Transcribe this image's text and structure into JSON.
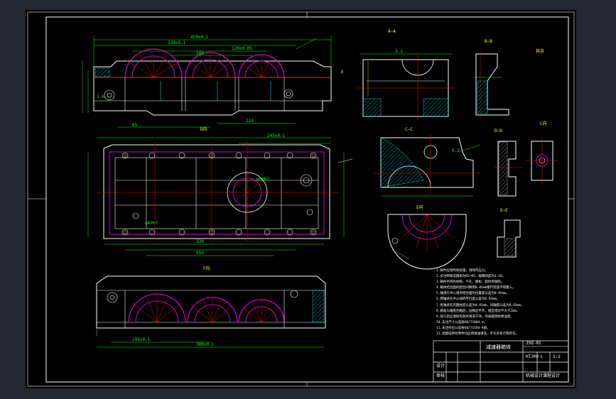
{
  "section_labels": {
    "a_a": "A—A",
    "b_b": "B—B",
    "c_c": "C—C",
    "d_d": "D—D",
    "e_e": "E—E",
    "f_f": "F",
    "view_d": "D向",
    "view_c": "C向",
    "view_e": "E向",
    "view_f": "F向",
    "other": "其余"
  },
  "dimensions": {
    "d1": "220±0.1",
    "d2": "245±0.1",
    "d3": "450±0.1",
    "d4": "120±0.05",
    "d5": "180",
    "d6": "330",
    "d7": "550",
    "d8": "65",
    "d9": "110",
    "d10": "φ80H7",
    "d11": "φ62H7",
    "d12": "195±0.1",
    "d13": "380±0.1",
    "d14": "3.2",
    "d15": "6.3",
    "d16": "1.6"
  },
  "technical_requirements": [
    "1.铸件应经时效处理，消除内应力。",
    "2.未注明铸造圆角为R3~R5，拔模斜度为1:20。",
    "3.铸件不得有砂眼、气孔、缩松、裂纹等缺陷。",
    "4.箱体结合面的配合间隙用0.05mm塞尺检查不得塞入。",
    "5.轴承孔中心线对结合面的位置度公差为0.05mm。",
    "6.两轴承孔中心线的平行度公差为0.03mm。",
    "7.各轴承孔的圆柱度公差为0.01mm，同轴度公差为0.02mm。",
    "8.箱盖与箱座合箱后，边缘应平齐，相互错位不大于2mm。",
    "9.加工后应清除毛刺并清洗干净，内表面涂防锈油漆。",
    "10.未注尺寸公差按GB/T1804-m。",
    "11.未注形位公差按GB/T1184-K级。",
    "12.装配前所有零件均应用煤油清洗，不允许有污物存在。",
    "13.箱座与箱盖合箱后用螺栓连接并配作定位销孔。"
  ],
  "title_block": {
    "part_name": "减速器箱体",
    "drawing_no": "JSQ-01",
    "material": "HT200",
    "scale": "1:2",
    "sheet": "1",
    "school": "机械设计课程设计",
    "designer": "设计",
    "checker": "审核"
  },
  "colors": {
    "frame": "#ffffff",
    "outline": "#ffffff",
    "hidden": "#ffff00",
    "center": "#ff0000",
    "dimension": "#00ff00",
    "hatch": "#00ffff",
    "magenta": "#ff00ff",
    "background": "#000000",
    "surround": "#212830"
  }
}
